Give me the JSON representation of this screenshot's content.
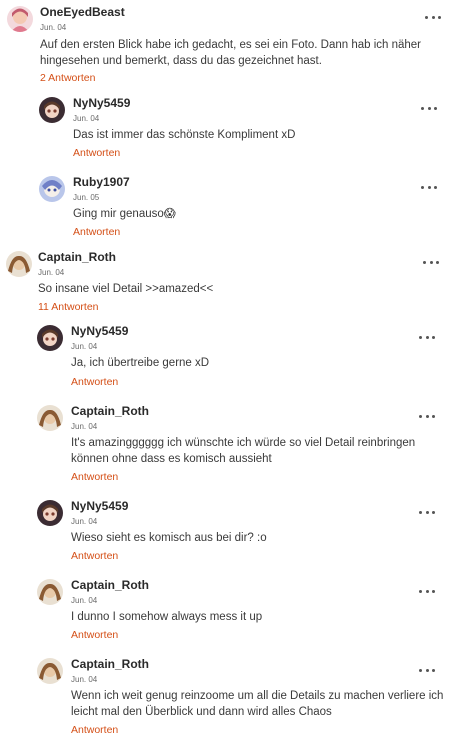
{
  "comments": [
    {
      "user": "OneEyedBeast",
      "date": "Jun. 04",
      "text": "Auf den ersten Blick habe ich gedacht, es sei ein Foto. Dann hab ich näher hingesehen und bemerkt, dass du das gezeichnet hast.",
      "action": "2 Antworten",
      "avatar": "avatar-oneeyedbeast"
    },
    {
      "user": "NyNy5459",
      "date": "Jun. 04",
      "text": "Das ist immer das schönste Kompliment xD",
      "action": "Antworten",
      "avatar": "avatar-nyny"
    },
    {
      "user": "Ruby1907",
      "date": "Jun. 05",
      "text": "Ging mir genauso😱",
      "action": "Antworten",
      "avatar": "avatar-ruby"
    },
    {
      "user": "Captain_Roth",
      "date": "Jun. 04",
      "text": "So insane viel Detail >>amazed<<",
      "action": "11 Antworten",
      "avatar": "avatar-captain"
    },
    {
      "user": "NyNy5459",
      "date": "Jun. 04",
      "text": "Ja, ich übertreibe gerne xD",
      "action": "Antworten",
      "avatar": "avatar-nyny"
    },
    {
      "user": "Captain_Roth",
      "date": "Jun. 04",
      "text": "It's amazingggggg ich wünschte ich würde so viel Detail reinbringen können ohne dass es komisch aussieht",
      "action": "Antworten",
      "avatar": "avatar-captain"
    },
    {
      "user": "NyNy5459",
      "date": "Jun. 04",
      "text": "Wieso sieht es komisch aus bei dir? :o",
      "action": "Antworten",
      "avatar": "avatar-nyny"
    },
    {
      "user": "Captain_Roth",
      "date": "Jun. 04",
      "text": "I dunno I somehow always mess it up",
      "action": "Antworten",
      "avatar": "avatar-captain"
    },
    {
      "user": "Captain_Roth",
      "date": "Jun. 04",
      "text": "Wenn ich weit genug reinzoome um all die Details zu machen verliere ich leicht mal den Überblick und dann wird alles Chaos",
      "action": "Antworten",
      "avatar": "avatar-captain"
    }
  ],
  "more_icon": "more-options-icon",
  "colors": {
    "accent": "#d44f17",
    "username": "#2a2a2a",
    "date": "#6b6b6b",
    "text": "#3a3a3a"
  }
}
